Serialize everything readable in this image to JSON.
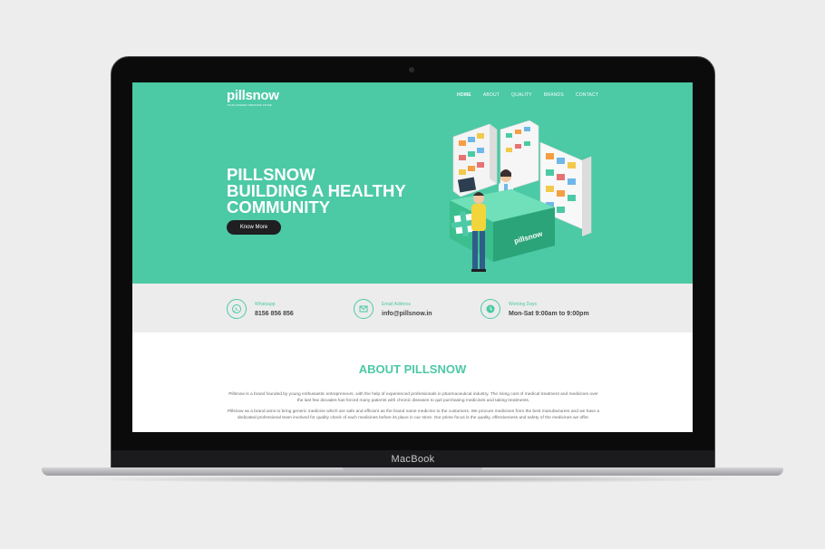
{
  "device": {
    "brand_label": "MacBook"
  },
  "site": {
    "logo": {
      "name": "pillsnow",
      "tagline": "YOUR GENERIC MEDICINE STORE"
    },
    "nav": {
      "items": [
        {
          "label": "HOME",
          "active": true
        },
        {
          "label": "ABOUT"
        },
        {
          "label": "QUALITY"
        },
        {
          "label": "BRANDS"
        },
        {
          "label": "CONTACT"
        }
      ]
    },
    "hero": {
      "headline": [
        "PILLSNOW",
        "BUILDING A HEALTHY",
        "COMMUNITY"
      ],
      "cta_label": "Know More",
      "counter_sign": "pillsnow",
      "bg_color": "#4cc9a5"
    },
    "contact": {
      "whatsapp": {
        "label": "Whatsapp",
        "value": "8156 856 856",
        "icon": "whatsapp-icon"
      },
      "email": {
        "label": "Email Address",
        "value": "info@pillsnow.in",
        "icon": "mail-icon"
      },
      "hours": {
        "label": "Working Days",
        "value": "Mon-Sat 9:00am to 9:00pm",
        "icon": "clock-icon"
      }
    },
    "about": {
      "title": "ABOUT PILLSNOW",
      "paragraphs": [
        "Pillsnow is a brand founded by young enthusiastic entrepreneurs, with the help of experienced professionals in pharmaceutical industry. The rising cost of medical treatment and medicines over the last few decades has forced many patients with chronic diseases to quit purchasing medicines and taking treatments.",
        "Pillsnow as a brand aims to bring generic medicine which are safe and efficient as the brand name medicine to the customers. We procure medicines from the best manufacturers and we have a dedicated professional team involved for quality check of each medicines before its place in our store. Our prime focus is the quality, effectiveness and safety of the medicines we offer."
      ]
    }
  }
}
